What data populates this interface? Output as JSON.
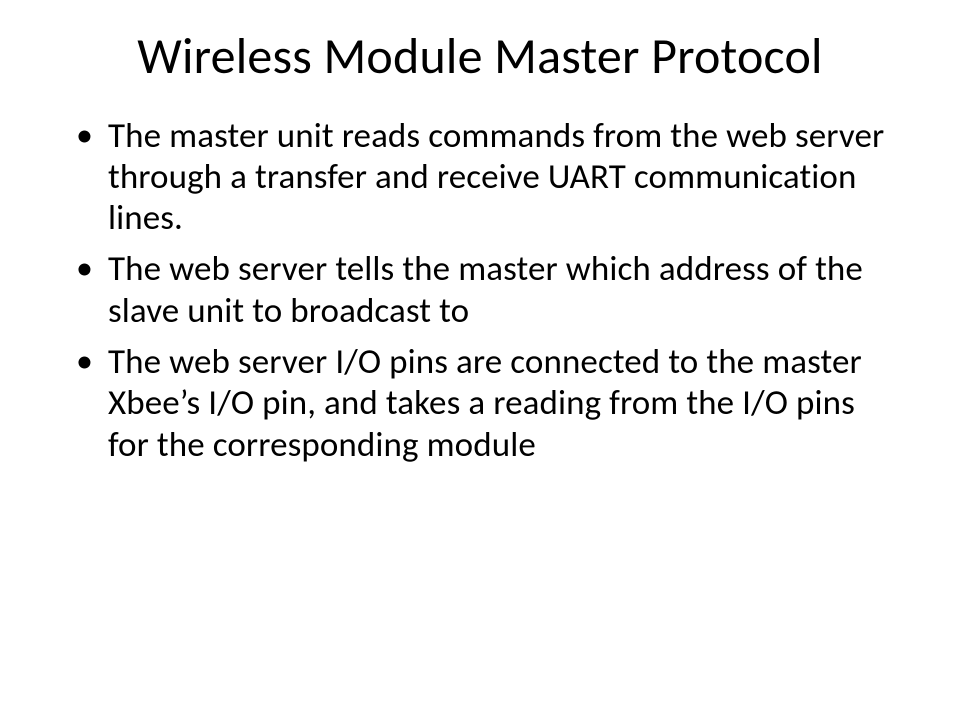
{
  "slide": {
    "title": "Wireless Module Master Protocol",
    "bullets": [
      "The master unit reads commands from the web server through a transfer and receive UART communication lines.",
      "The web server tells the master which address of the slave unit to broadcast to",
      "The web server I/O pins are connected to the master Xbee’s I/O pin, and takes a reading from the I/O pins for the corresponding module"
    ]
  }
}
